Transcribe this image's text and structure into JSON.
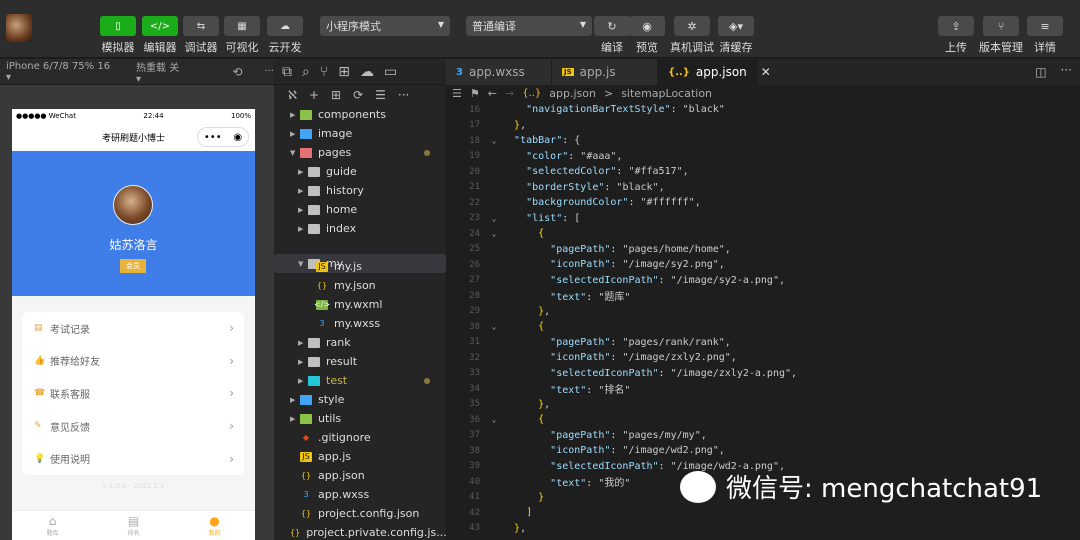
{
  "toolbar": {
    "buttons": [
      {
        "label": "模拟器",
        "icon": "phone-icon"
      },
      {
        "label": "编辑器",
        "icon": "code-icon"
      },
      {
        "label": "调试器",
        "icon": "debug-icon"
      },
      {
        "label": "可视化",
        "icon": "layout-icon"
      },
      {
        "label": "云开发",
        "icon": "cloud-icon"
      }
    ],
    "mode_select": "小程序模式",
    "compile_select": "普通编译",
    "actions": [
      {
        "label": "编译",
        "icon": "refresh-icon"
      },
      {
        "label": "预览",
        "icon": "eye-icon"
      },
      {
        "label": "真机调试",
        "icon": "bug-icon"
      },
      {
        "label": "清缓存",
        "icon": "layers-icon"
      }
    ],
    "right": [
      {
        "label": "上传",
        "icon": "upload-icon"
      },
      {
        "label": "版本管理",
        "icon": "branch-icon"
      },
      {
        "label": "详情",
        "icon": "menu-icon"
      }
    ]
  },
  "sim_bar": {
    "device": "iPhone 6/7/8 75% 16 ▾",
    "hot": "热重载 关 ▾"
  },
  "phone": {
    "carrier": "●●●●● WeChat",
    "time": "22:44",
    "battery": "100%",
    "nav_title": "考研刷题小博士",
    "user_name": "姑苏洛言",
    "user_badge": "会员",
    "menu": [
      "考试记录",
      "推荐给好友",
      "联系客服",
      "意见反馈",
      "使用说明"
    ],
    "version": "v 1.0.0 · 2022.1.1",
    "tabs": [
      "题库",
      "排名",
      "我的"
    ]
  },
  "tabs": [
    {
      "label": "app.wxss",
      "icon": "wxss",
      "color": "#42a5f5"
    },
    {
      "label": "app.js",
      "icon": "JS",
      "color": "#f1c40f"
    },
    {
      "label": "app.json",
      "icon": "{..}",
      "color": "#f1c40f"
    }
  ],
  "breadcrumb": {
    "file": "app.json",
    "sep": ">",
    "path": "sitemapLocation"
  },
  "tree": [
    {
      "name": "components",
      "kind": "folder",
      "color": "g",
      "depth": 1,
      "open": false
    },
    {
      "name": "image",
      "kind": "folder",
      "color": "b",
      "depth": 1,
      "open": false
    },
    {
      "name": "pages",
      "kind": "folder",
      "color": "o",
      "depth": 1,
      "open": true,
      "dot": true
    },
    {
      "name": "guide",
      "kind": "folder",
      "color": "",
      "depth": 2,
      "open": false
    },
    {
      "name": "history",
      "kind": "folder",
      "color": "",
      "depth": 2,
      "open": false
    },
    {
      "name": "home",
      "kind": "folder",
      "color": "",
      "depth": 2,
      "open": false
    },
    {
      "name": "index",
      "kind": "folder",
      "color": "",
      "depth": 2,
      "open": false
    },
    {
      "name": "my",
      "kind": "folder",
      "color": "",
      "depth": 2,
      "open": true,
      "selected": true
    },
    {
      "name": "my.js",
      "kind": "js",
      "depth": 3
    },
    {
      "name": "my.json",
      "kind": "json",
      "depth": 3
    },
    {
      "name": "my.wxml",
      "kind": "wxml",
      "depth": 3
    },
    {
      "name": "my.wxss",
      "kind": "wxss",
      "depth": 3
    },
    {
      "name": "rank",
      "kind": "folder",
      "color": "",
      "depth": 2,
      "open": false
    },
    {
      "name": "result",
      "kind": "folder",
      "color": "",
      "depth": 2,
      "open": false
    },
    {
      "name": "test",
      "kind": "folder",
      "color": "t",
      "depth": 2,
      "open": false,
      "dot": true
    },
    {
      "name": "style",
      "kind": "folder",
      "color": "b",
      "depth": 1,
      "open": false
    },
    {
      "name": "utils",
      "kind": "folder",
      "color": "g",
      "depth": 1,
      "open": false
    },
    {
      "name": ".gitignore",
      "kind": "git",
      "depth": 1
    },
    {
      "name": "app.js",
      "kind": "js",
      "depth": 1
    },
    {
      "name": "app.json",
      "kind": "json",
      "depth": 1
    },
    {
      "name": "app.wxss",
      "kind": "wxss",
      "depth": 1
    },
    {
      "name": "project.config.json",
      "kind": "json",
      "depth": 1
    },
    {
      "name": "project.private.config.js...",
      "kind": "json",
      "depth": 1
    }
  ],
  "code": [
    {
      "n": "16",
      "t": "    \"navigationBarTextStyle\": \"black\""
    },
    {
      "n": "17",
      "t": "  },"
    },
    {
      "n": "18",
      "t": "  \"tabBar\": {",
      "f": true
    },
    {
      "n": "19",
      "t": "    \"color\": \"#aaa\","
    },
    {
      "n": "20",
      "t": "    \"selectedColor\": \"#ffa517\","
    },
    {
      "n": "21",
      "t": "    \"borderStyle\": \"black\","
    },
    {
      "n": "22",
      "t": "    \"backgroundColor\": \"#ffffff\","
    },
    {
      "n": "23",
      "t": "    \"list\": [",
      "f": true
    },
    {
      "n": "24",
      "t": "      {",
      "f": true
    },
    {
      "n": "25",
      "t": "        \"pagePath\": \"pages/home/home\","
    },
    {
      "n": "26",
      "t": "        \"iconPath\": \"/image/sy2.png\","
    },
    {
      "n": "27",
      "t": "        \"selectedIconPath\": \"/image/sy2-a.png\","
    },
    {
      "n": "28",
      "t": "        \"text\": \"题库\""
    },
    {
      "n": "29",
      "t": "      },"
    },
    {
      "n": "30",
      "t": "      {",
      "f": true
    },
    {
      "n": "31",
      "t": "        \"pagePath\": \"pages/rank/rank\","
    },
    {
      "n": "32",
      "t": "        \"iconPath\": \"/image/zxly2.png\","
    },
    {
      "n": "33",
      "t": "        \"selectedIconPath\": \"/image/zxly2-a.png\","
    },
    {
      "n": "34",
      "t": "        \"text\": \"排名\""
    },
    {
      "n": "35",
      "t": "      },"
    },
    {
      "n": "36",
      "t": "      {",
      "f": true
    },
    {
      "n": "37",
      "t": "        \"pagePath\": \"pages/my/my\","
    },
    {
      "n": "38",
      "t": "        \"iconPath\": \"/image/wd2.png\","
    },
    {
      "n": "39",
      "t": "        \"selectedIconPath\": \"/image/wd2-a.png\","
    },
    {
      "n": "40",
      "t": "        \"text\": \"我的\""
    },
    {
      "n": "41",
      "t": "      }"
    },
    {
      "n": "42",
      "t": "    ]"
    },
    {
      "n": "43",
      "t": "  },"
    }
  ],
  "watermark": "微信号: mengchatchat91",
  "colors": {
    "green": "#1aad19",
    "blue": "#3f7de8",
    "accent": "#ffa517"
  }
}
